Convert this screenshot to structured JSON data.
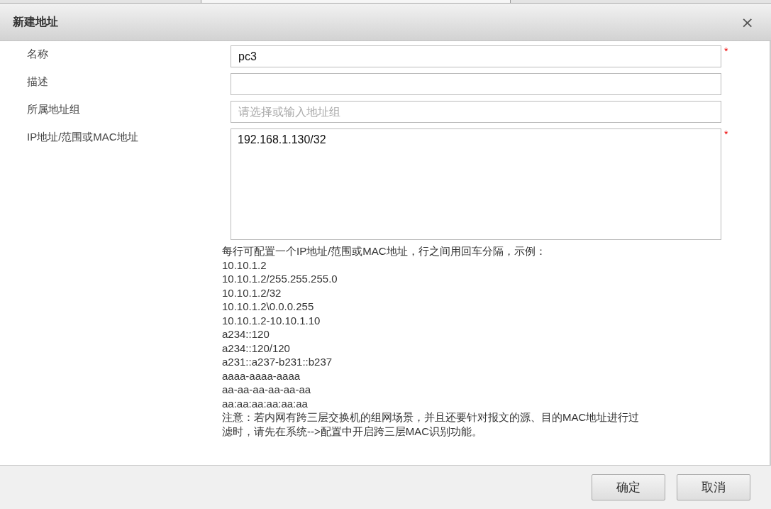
{
  "dialog": {
    "title": "新建地址",
    "close": "×"
  },
  "fields": [
    {
      "label": "名称",
      "kind": "input",
      "value": "pc3",
      "required_mark": "*"
    },
    {
      "label": "描述",
      "kind": "input"
    },
    {
      "label": "所属地址组",
      "kind": "input",
      "placeholder": "请选择或输入地址组"
    },
    {
      "label": "IP地址/范围或MAC地址",
      "kind": "textarea",
      "value": "192.168.1.130/32",
      "required_mark": "*"
    }
  ],
  "help": {
    "intro": "每行可配置一个IP地址/范围或MAC地址，行之间用回车分隔，示例：",
    "examples": [
      "10.10.1.2",
      "10.10.1.2/255.255.255.0",
      "10.10.1.2/32",
      "10.10.1.2\\0.0.0.255",
      "10.10.1.2-10.10.1.10",
      "a234::120",
      "a234::120/120",
      "a231::a237-b231::b237",
      "aaaa-aaaa-aaaa",
      "aa-aa-aa-aa-aa-aa",
      "aa:aa:aa:aa:aa:aa"
    ],
    "note": "注意：若内网有跨三层交换机的组网场景，并且还要针对报文的源、目的MAC地址进行过滤时，请先在系统-->配置中开启跨三层MAC识别功能。"
  },
  "buttons": [
    "确定",
    "取消"
  ]
}
